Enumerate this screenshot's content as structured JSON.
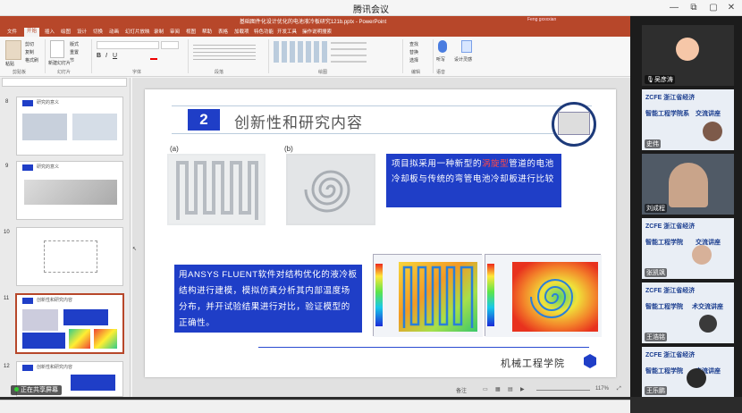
{
  "window": {
    "title": "腾讯会议",
    "minimize": "—",
    "maximize": "▢",
    "restore": "⧉",
    "close": "✕"
  },
  "ppt": {
    "doc_title": "基础图件化设计优化的电池液冷板研究121b.pptx - PowerPoint",
    "user": "Feng gxxxxian",
    "tabs": [
      "文件",
      "开始",
      "插入",
      "绘图",
      "设计",
      "切换",
      "动画",
      "幻灯片放映",
      "录制",
      "审阅",
      "视图",
      "帮助",
      "表格",
      "加载项",
      "特色功能",
      "开发工具",
      "操作说明搜索"
    ],
    "active_tab": "开始",
    "ribbon": {
      "clipboard": "剪贴板",
      "slides": "幻灯片",
      "font": "字体",
      "paragraph": "段落",
      "drawing": "绘图",
      "editing": "编辑",
      "voice": "语音",
      "paste": "粘贴",
      "cut": "剪切",
      "copy": "复制",
      "format": "格式刷",
      "new_slide": "新建幻灯片",
      "layout": "版式",
      "reset": "重置",
      "section": "节",
      "find": "查找",
      "replace": "替换",
      "select": "选择",
      "dictate": "听写",
      "design_ideas": "设计灵感"
    },
    "thumbnails": [
      {
        "num": "8",
        "title": "研究的意义"
      },
      {
        "num": "9",
        "title": "研究的意义"
      },
      {
        "num": "10",
        "title": ""
      },
      {
        "num": "11",
        "title": "创新性和研究内容"
      },
      {
        "num": "12",
        "title": "创新性和研究内容"
      }
    ],
    "slide": {
      "section_number": "2",
      "section_title": "创新性和研究内容",
      "label_a": "(a)",
      "label_b": "(b)",
      "box1_pre": "项目拟采用一种新型的",
      "box1_highlight": "涡旋型",
      "box1_post": "管道的电池冷却板与传统的弯管电池冷却板进行比较",
      "box2_text": "用ANSYS FLUENT软件对结构优化的液冷板结构进行建模，模拟仿真分析其内部温度场分布，并开试验结果进行对比，验证模型的正确性。",
      "footer": "机械工程学院"
    },
    "status": {
      "share_badge": "正在共享屏幕",
      "notes": "备注",
      "zoom": "117%"
    }
  },
  "participants": [
    {
      "name": "吴彦涛",
      "kind": "avatar"
    },
    {
      "name": "史伟",
      "kind": "banner",
      "banner_logo": "ZCFE 浙江省经济",
      "banner_text": "智能工程学院系",
      "banner_sub": "交流讲座"
    },
    {
      "name": "刘成程",
      "kind": "video"
    },
    {
      "name": "张凯飒",
      "kind": "banner",
      "banner_logo": "ZCFE 浙江省经济",
      "banner_text": "智能工程学院",
      "banner_sub": "交流讲座"
    },
    {
      "name": "王浩铭",
      "kind": "banner",
      "banner_logo": "ZCFE 浙江省经济",
      "banner_text": "智能工程学院",
      "banner_sub": "术交流讲座"
    },
    {
      "name": "王乐鹏",
      "kind": "banner",
      "banner_logo": "ZCFE 浙江省经济",
      "banner_text": "智能工程学院",
      "banner_sub": "交流讲座"
    }
  ],
  "colors": {
    "ppt_accent": "#b7472a",
    "slide_blue": "#1f3ec7",
    "highlight_red": "#ff4a4a"
  }
}
